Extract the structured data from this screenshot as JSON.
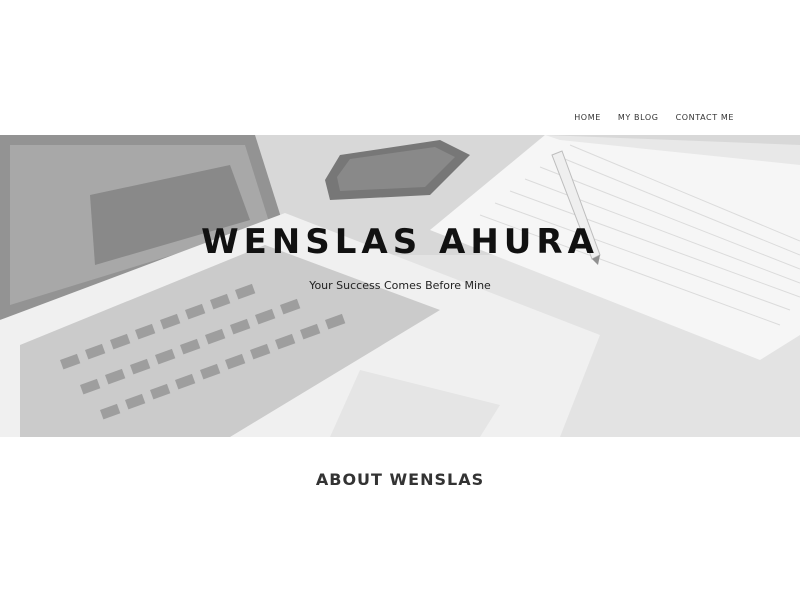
{
  "nav": {
    "items": [
      {
        "label": "HOME"
      },
      {
        "label": "MY BLOG"
      },
      {
        "label": "CONTACT ME"
      }
    ]
  },
  "hero": {
    "title": "WENSLAS AHURA",
    "subtitle": "Your Success Comes Before Mine"
  },
  "about": {
    "heading": "ABOUT WENSLAS"
  }
}
